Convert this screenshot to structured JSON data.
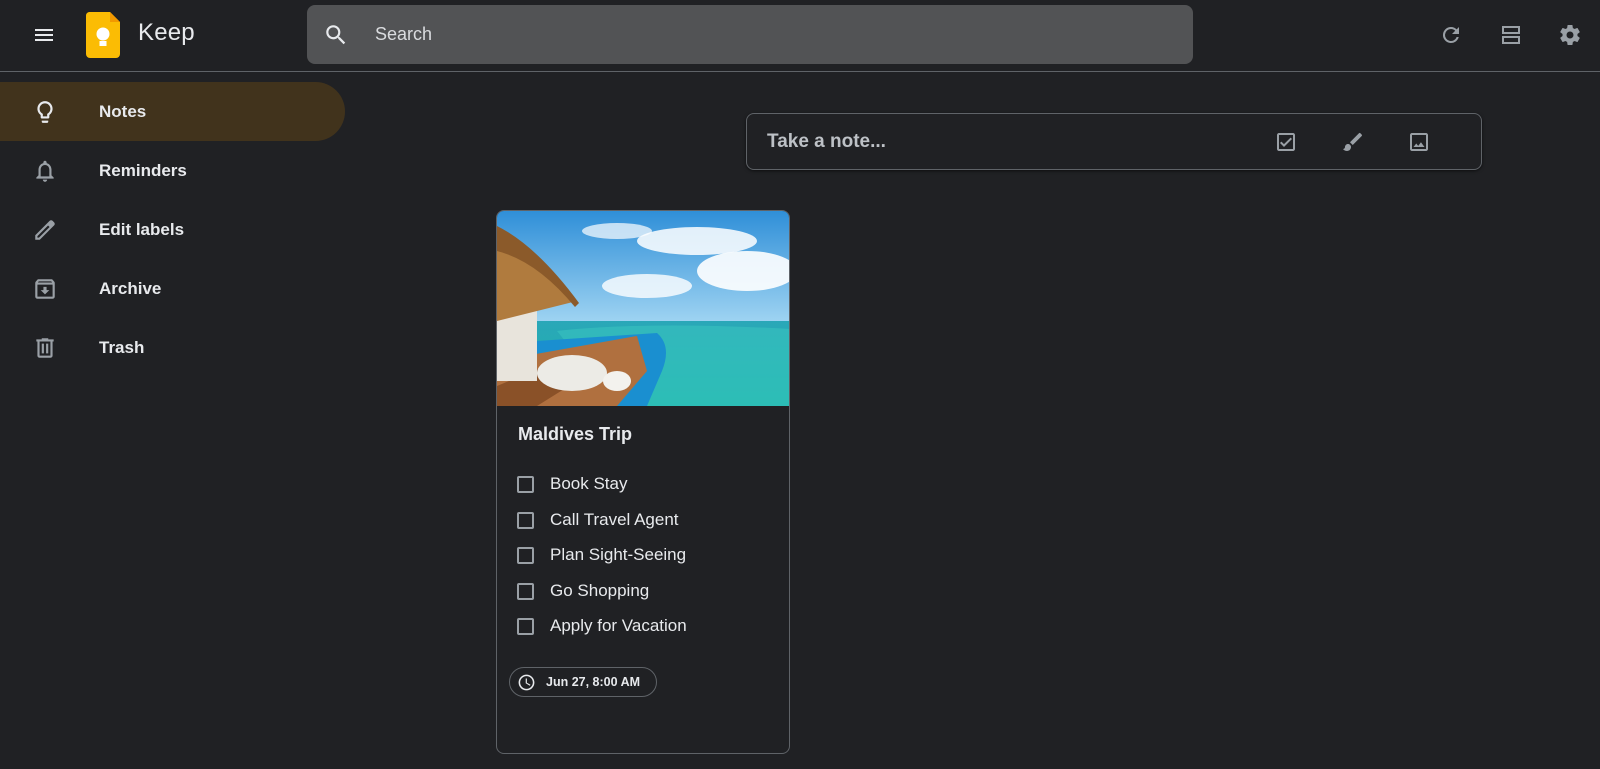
{
  "header": {
    "app_title": "Keep",
    "search_placeholder": "Search",
    "icons": [
      "menu-icon",
      "keep-logo",
      "search-icon",
      "refresh-icon",
      "list-view-icon",
      "settings-icon"
    ]
  },
  "sidebar": {
    "items": [
      {
        "label": "Notes",
        "icon": "lightbulb-icon",
        "active": true
      },
      {
        "label": "Reminders",
        "icon": "bell-icon",
        "active": false
      },
      {
        "label": "Edit labels",
        "icon": "pencil-icon",
        "active": false
      },
      {
        "label": "Archive",
        "icon": "archive-icon",
        "active": false
      },
      {
        "label": "Trash",
        "icon": "trash-icon",
        "active": false
      }
    ]
  },
  "take_note": {
    "placeholder": "Take a note...",
    "icons": [
      "checkbox-icon",
      "brush-icon",
      "image-icon"
    ]
  },
  "note": {
    "title": "Maldives Trip",
    "checklist": [
      {
        "label": "Book Stay",
        "checked": false
      },
      {
        "label": "Call Travel Agent",
        "checked": false
      },
      {
        "label": "Plan Sight-Seeing",
        "checked": false
      },
      {
        "label": "Go Shopping",
        "checked": false
      },
      {
        "label": "Apply for Vacation",
        "checked": false
      }
    ],
    "reminder": "Jun 27, 8:00 AM"
  },
  "colors": {
    "background": "#202124",
    "active_nav": "#41331c",
    "search_bg": "#525355",
    "border": "#5f6368",
    "text": "#e8eaed",
    "logo_yellow": "#fbbc04"
  }
}
